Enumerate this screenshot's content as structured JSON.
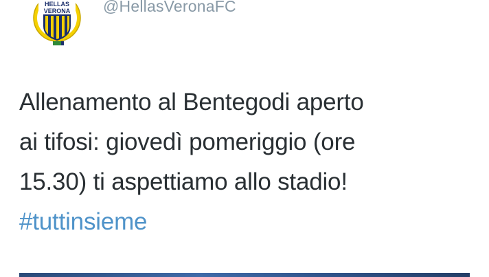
{
  "tweet": {
    "handle": "@HellasVeronaFC",
    "text_lines": [
      "Allenamento al Bentegodi aperto",
      "ai tifosi: giovedì pomeriggio (ore",
      "15.30) ti aspettiamo allo stadio!"
    ],
    "hashtag": "#tuttinsieme"
  },
  "avatar": {
    "crest_text_top": "HELLAS",
    "crest_text_bottom": "VERONA",
    "icon": "hellas-verona-crest-icon"
  },
  "colors": {
    "text": "#292f33",
    "handle": "#8899a6",
    "hashtag": "#4f93c9",
    "crest_yellow": "#f5d000",
    "crest_blue": "#1b2f6b",
    "crest_green": "#2f8a3a"
  }
}
